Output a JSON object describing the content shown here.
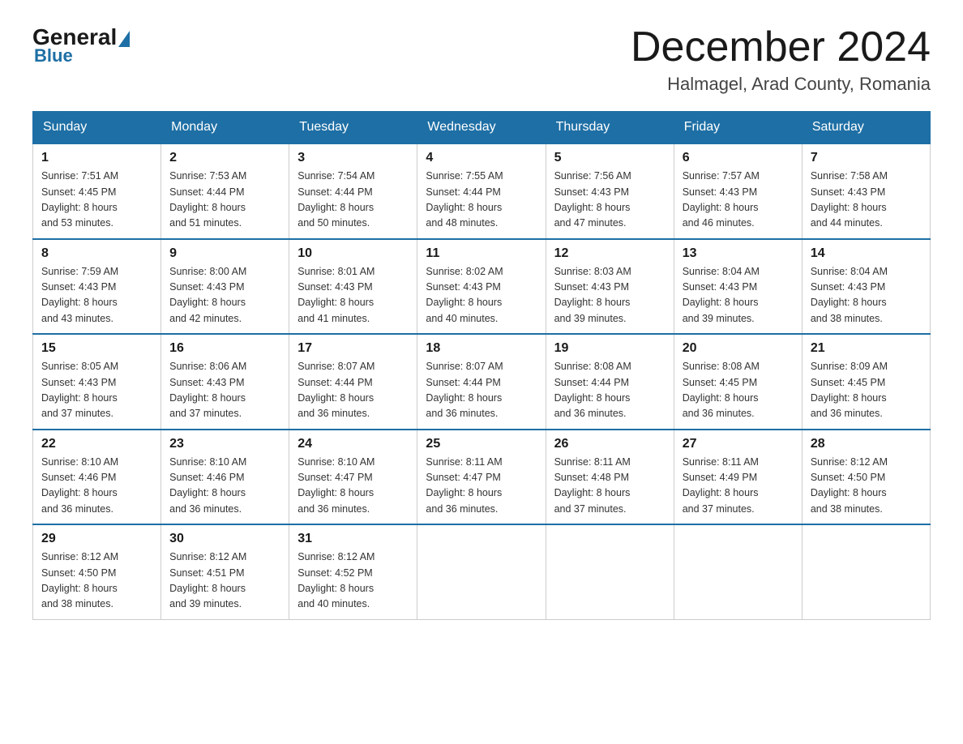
{
  "header": {
    "logo": {
      "general": "General",
      "blue": "Blue"
    },
    "title": "December 2024",
    "location": "Halmagel, Arad County, Romania"
  },
  "weekdays": [
    "Sunday",
    "Monday",
    "Tuesday",
    "Wednesday",
    "Thursday",
    "Friday",
    "Saturday"
  ],
  "weeks": [
    [
      {
        "day": "1",
        "sunrise": "7:51 AM",
        "sunset": "4:45 PM",
        "daylight": "8 hours and 53 minutes."
      },
      {
        "day": "2",
        "sunrise": "7:53 AM",
        "sunset": "4:44 PM",
        "daylight": "8 hours and 51 minutes."
      },
      {
        "day": "3",
        "sunrise": "7:54 AM",
        "sunset": "4:44 PM",
        "daylight": "8 hours and 50 minutes."
      },
      {
        "day": "4",
        "sunrise": "7:55 AM",
        "sunset": "4:44 PM",
        "daylight": "8 hours and 48 minutes."
      },
      {
        "day": "5",
        "sunrise": "7:56 AM",
        "sunset": "4:43 PM",
        "daylight": "8 hours and 47 minutes."
      },
      {
        "day": "6",
        "sunrise": "7:57 AM",
        "sunset": "4:43 PM",
        "daylight": "8 hours and 46 minutes."
      },
      {
        "day": "7",
        "sunrise": "7:58 AM",
        "sunset": "4:43 PM",
        "daylight": "8 hours and 44 minutes."
      }
    ],
    [
      {
        "day": "8",
        "sunrise": "7:59 AM",
        "sunset": "4:43 PM",
        "daylight": "8 hours and 43 minutes."
      },
      {
        "day": "9",
        "sunrise": "8:00 AM",
        "sunset": "4:43 PM",
        "daylight": "8 hours and 42 minutes."
      },
      {
        "day": "10",
        "sunrise": "8:01 AM",
        "sunset": "4:43 PM",
        "daylight": "8 hours and 41 minutes."
      },
      {
        "day": "11",
        "sunrise": "8:02 AM",
        "sunset": "4:43 PM",
        "daylight": "8 hours and 40 minutes."
      },
      {
        "day": "12",
        "sunrise": "8:03 AM",
        "sunset": "4:43 PM",
        "daylight": "8 hours and 39 minutes."
      },
      {
        "day": "13",
        "sunrise": "8:04 AM",
        "sunset": "4:43 PM",
        "daylight": "8 hours and 39 minutes."
      },
      {
        "day": "14",
        "sunrise": "8:04 AM",
        "sunset": "4:43 PM",
        "daylight": "8 hours and 38 minutes."
      }
    ],
    [
      {
        "day": "15",
        "sunrise": "8:05 AM",
        "sunset": "4:43 PM",
        "daylight": "8 hours and 37 minutes."
      },
      {
        "day": "16",
        "sunrise": "8:06 AM",
        "sunset": "4:43 PM",
        "daylight": "8 hours and 37 minutes."
      },
      {
        "day": "17",
        "sunrise": "8:07 AM",
        "sunset": "4:44 PM",
        "daylight": "8 hours and 36 minutes."
      },
      {
        "day": "18",
        "sunrise": "8:07 AM",
        "sunset": "4:44 PM",
        "daylight": "8 hours and 36 minutes."
      },
      {
        "day": "19",
        "sunrise": "8:08 AM",
        "sunset": "4:44 PM",
        "daylight": "8 hours and 36 minutes."
      },
      {
        "day": "20",
        "sunrise": "8:08 AM",
        "sunset": "4:45 PM",
        "daylight": "8 hours and 36 minutes."
      },
      {
        "day": "21",
        "sunrise": "8:09 AM",
        "sunset": "4:45 PM",
        "daylight": "8 hours and 36 minutes."
      }
    ],
    [
      {
        "day": "22",
        "sunrise": "8:10 AM",
        "sunset": "4:46 PM",
        "daylight": "8 hours and 36 minutes."
      },
      {
        "day": "23",
        "sunrise": "8:10 AM",
        "sunset": "4:46 PM",
        "daylight": "8 hours and 36 minutes."
      },
      {
        "day": "24",
        "sunrise": "8:10 AM",
        "sunset": "4:47 PM",
        "daylight": "8 hours and 36 minutes."
      },
      {
        "day": "25",
        "sunrise": "8:11 AM",
        "sunset": "4:47 PM",
        "daylight": "8 hours and 36 minutes."
      },
      {
        "day": "26",
        "sunrise": "8:11 AM",
        "sunset": "4:48 PM",
        "daylight": "8 hours and 37 minutes."
      },
      {
        "day": "27",
        "sunrise": "8:11 AM",
        "sunset": "4:49 PM",
        "daylight": "8 hours and 37 minutes."
      },
      {
        "day": "28",
        "sunrise": "8:12 AM",
        "sunset": "4:50 PM",
        "daylight": "8 hours and 38 minutes."
      }
    ],
    [
      {
        "day": "29",
        "sunrise": "8:12 AM",
        "sunset": "4:50 PM",
        "daylight": "8 hours and 38 minutes."
      },
      {
        "day": "30",
        "sunrise": "8:12 AM",
        "sunset": "4:51 PM",
        "daylight": "8 hours and 39 minutes."
      },
      {
        "day": "31",
        "sunrise": "8:12 AM",
        "sunset": "4:52 PM",
        "daylight": "8 hours and 40 minutes."
      },
      null,
      null,
      null,
      null
    ]
  ],
  "labels": {
    "sunrise": "Sunrise:",
    "sunset": "Sunset:",
    "daylight": "Daylight:"
  }
}
